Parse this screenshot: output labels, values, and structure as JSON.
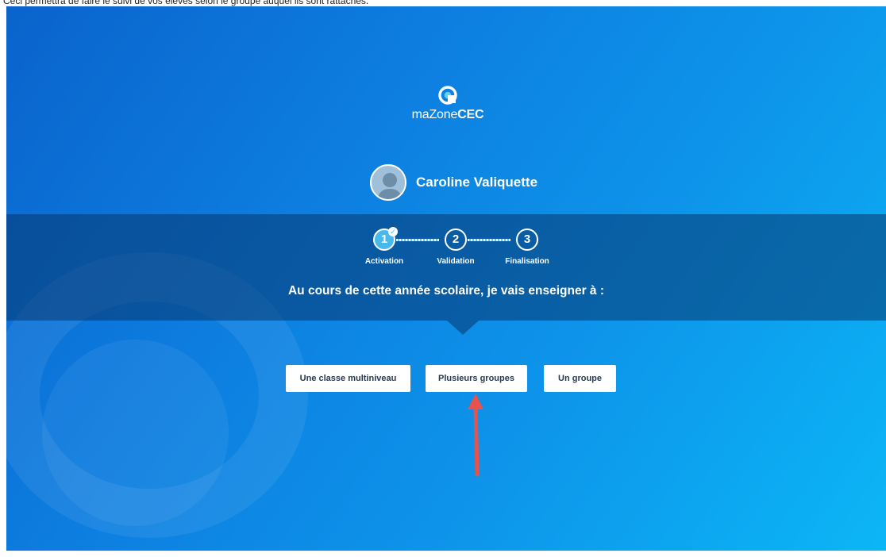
{
  "top_note": "Ceci permettra de faire le suivi de vos élèves selon le groupe auquel ils sont rattachés.",
  "brand": {
    "prefix": "maZone",
    "suffix": "CEC"
  },
  "user": {
    "name": "Caroline Valiquette"
  },
  "steps": [
    {
      "number": "1",
      "label": "Activation",
      "state": "active-completed"
    },
    {
      "number": "2",
      "label": "Validation",
      "state": "pending"
    },
    {
      "number": "3",
      "label": "Finalisation",
      "state": "pending"
    }
  ],
  "question": "Au cours de cette année scolaire, je vais enseigner à :",
  "choices": [
    {
      "label": "Une classe multiniveau"
    },
    {
      "label": "Plusieurs groupes"
    },
    {
      "label": "Un groupe"
    }
  ],
  "icons": {
    "logo": "mazone-logo-icon",
    "avatar": "user-avatar-icon",
    "check": "check-icon",
    "pointer": "red-arrow-annotation"
  },
  "colors": {
    "accent": "#49b8ea",
    "background_start": "#0a63cc",
    "background_end": "#0cb6f6",
    "annotation": "#e8524a"
  }
}
